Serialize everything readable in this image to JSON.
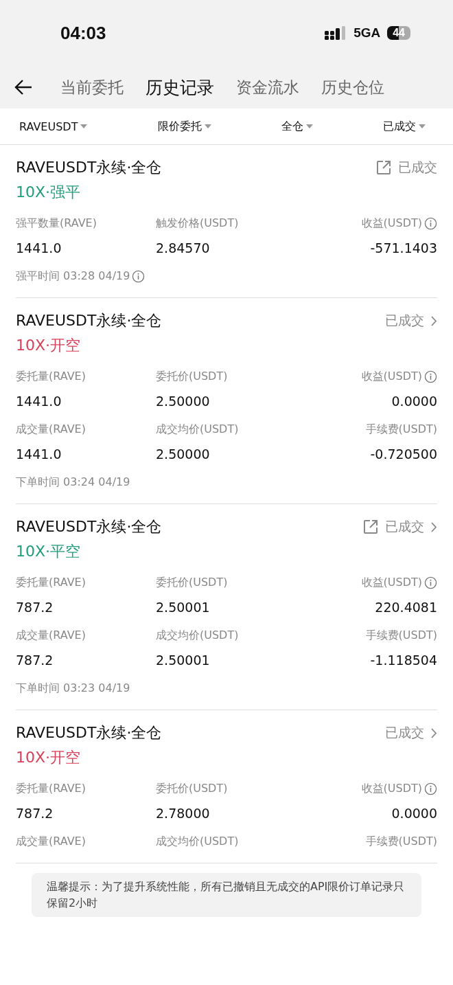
{
  "status_bar": {
    "time": "04:03",
    "network": "5GA",
    "battery": "44"
  },
  "tabs": [
    {
      "label": "当前委托",
      "selected": false
    },
    {
      "label": "历史记录",
      "selected": true
    },
    {
      "label": "资金流水",
      "selected": false
    },
    {
      "label": "历史仓位",
      "selected": false
    }
  ],
  "filters": [
    "RAVEUSDT",
    "限价委托",
    "全仓",
    "已成交"
  ],
  "orders": [
    {
      "title": "RAVEUSDT永续·全仓",
      "side": "10X·强平",
      "color": "#1f9e7a",
      "status": "已成交",
      "share": true,
      "chevron": false,
      "rows": [
        [
          {
            "label": "强平数量(RAVE)",
            "value": "1441.0",
            "info": false
          },
          {
            "label": "触发价格(USDT)",
            "value": "2.84570",
            "info": false
          },
          {
            "label": "收益(USDT)",
            "value": "-571.1403",
            "info": true
          }
        ]
      ],
      "time": "强平时间 03:28 04/19",
      "time_info": true
    },
    {
      "title": "RAVEUSDT永续·全仓",
      "side": "10X·开空",
      "color": "#d9405a",
      "status": "已成交",
      "share": false,
      "chevron": true,
      "rows": [
        [
          {
            "label": "委托量(RAVE)",
            "value": "1441.0",
            "info": false
          },
          {
            "label": "委托价(USDT)",
            "value": "2.50000",
            "info": false
          },
          {
            "label": "收益(USDT)",
            "value": "0.0000",
            "info": true
          }
        ],
        [
          {
            "label": "成交量(RAVE)",
            "value": "1441.0",
            "info": false
          },
          {
            "label": "成交均价(USDT)",
            "value": "2.50000",
            "info": false
          },
          {
            "label": "手续费(USDT)",
            "value": "-0.720500",
            "info": false
          }
        ]
      ],
      "time": "下单时间 03:24 04/19",
      "time_info": false
    },
    {
      "title": "RAVEUSDT永续·全仓",
      "side": "10X·平空",
      "color": "#1f9e7a",
      "status": "已成交",
      "share": true,
      "chevron": true,
      "rows": [
        [
          {
            "label": "委托量(RAVE)",
            "value": "787.2",
            "info": false
          },
          {
            "label": "委托价(USDT)",
            "value": "2.50001",
            "info": false
          },
          {
            "label": "收益(USDT)",
            "value": "220.4081",
            "info": true
          }
        ],
        [
          {
            "label": "成交量(RAVE)",
            "value": "787.2",
            "info": false
          },
          {
            "label": "成交均价(USDT)",
            "value": "2.50001",
            "info": false
          },
          {
            "label": "手续费(USDT)",
            "value": "-1.118504",
            "info": false
          }
        ]
      ],
      "time": "下单时间 03:23 04/19",
      "time_info": false
    },
    {
      "title": "RAVEUSDT永续·全仓",
      "side": "10X·开空",
      "color": "#d9405a",
      "status": "已成交",
      "share": false,
      "chevron": true,
      "rows": [
        [
          {
            "label": "委托量(RAVE)",
            "value": "787.2",
            "info": false
          },
          {
            "label": "委托价(USDT)",
            "value": "2.78000",
            "info": false
          },
          {
            "label": "收益(USDT)",
            "value": "0.0000",
            "info": true
          }
        ],
        [
          {
            "label": "成交量(RAVE)",
            "info": false
          },
          {
            "label": "成交均价(USDT)",
            "info": false
          },
          {
            "label": "手续费(USDT)",
            "info": false
          }
        ]
      ]
    }
  ],
  "notice": "温馨提示：为了提升系统性能，所有已撤销且无成交的API限价订单记录只保留2小时"
}
